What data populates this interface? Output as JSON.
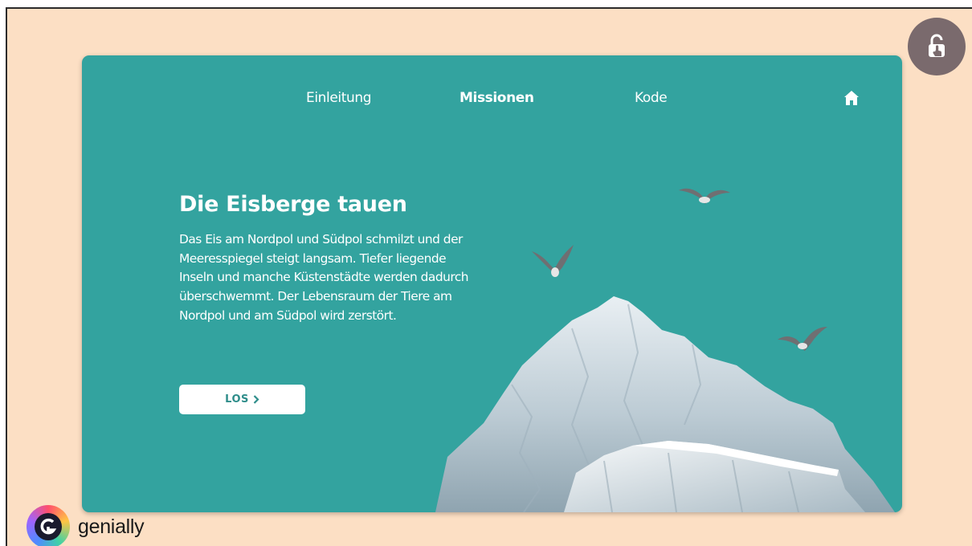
{
  "nav": {
    "items": [
      {
        "label": "Einleitung"
      },
      {
        "label": "Missionen"
      },
      {
        "label": "Kode"
      }
    ],
    "home_icon": "home-icon"
  },
  "content": {
    "title": "Die Eisberge tauen",
    "body": "Das Eis am Nordpol und Südpol schmilzt und der Meeresspiegel steigt langsam. Tiefer liegende Inseln und manche Küstenstädte werden dadurch überschwemmt. Der Lebensraum der Tiere am Nordpol und am Südpol wird zerstört.",
    "button_label": "LOS",
    "button_icon": "chevron-right-icon"
  },
  "overlay": {
    "unlock_icon": "unlock-icon"
  },
  "brand": {
    "name": "genially"
  },
  "colors": {
    "page_background": "#fcdfc4",
    "slide_background": "#33a39f",
    "button_text": "#2e8d8a",
    "unlock_button": "#7a6a6d"
  }
}
